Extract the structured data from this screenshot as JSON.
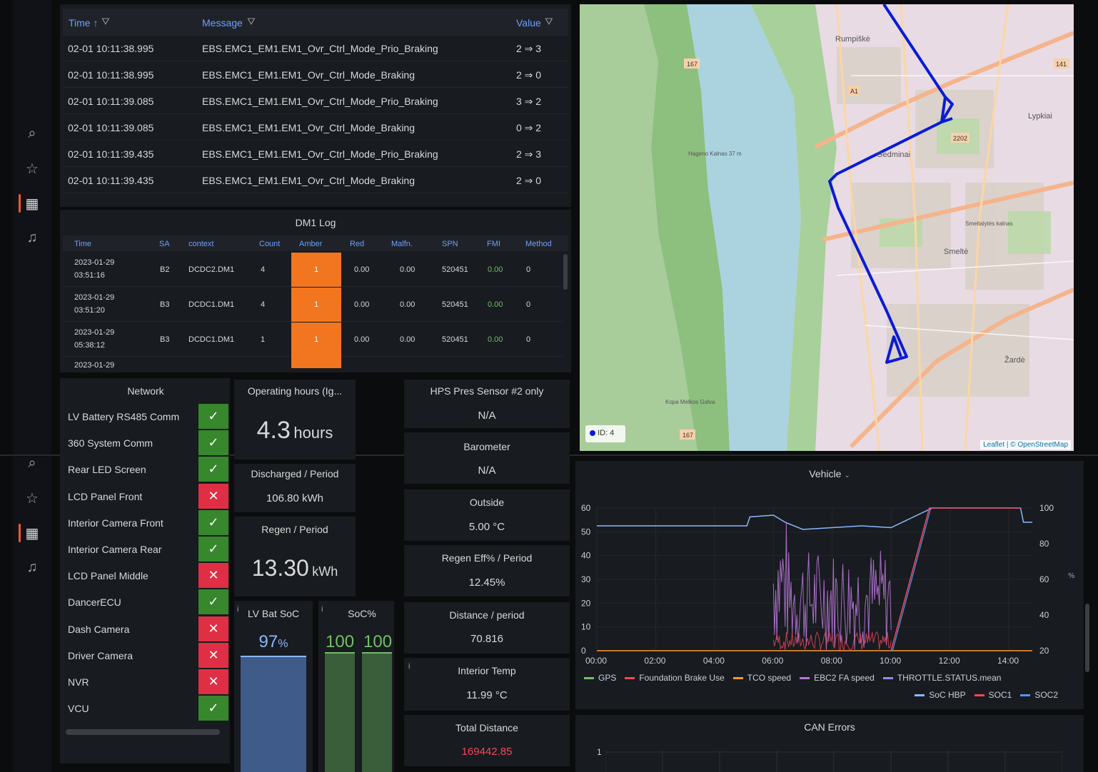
{
  "messages": {
    "headers": {
      "time": "Time ↑",
      "message": "Message",
      "value": "Value"
    },
    "rows": [
      {
        "time": "02-01 10:11:38.995",
        "message": "EBS.EMC1_EM1.EM1_Ovr_Ctrl_Mode_Prio_Braking",
        "value": "2 ⇒ 3"
      },
      {
        "time": "02-01 10:11:38.995",
        "message": "EBS.EMC1_EM1.EM1_Ovr_Ctrl_Mode_Braking",
        "value": "2 ⇒ 0"
      },
      {
        "time": "02-01 10:11:39.085",
        "message": "EBS.EMC1_EM1.EM1_Ovr_Ctrl_Mode_Prio_Braking",
        "value": "3 ⇒ 2"
      },
      {
        "time": "02-01 10:11:39.085",
        "message": "EBS.EMC1_EM1.EM1_Ovr_Ctrl_Mode_Braking",
        "value": "0 ⇒ 2"
      },
      {
        "time": "02-01 10:11:39.435",
        "message": "EBS.EMC1_EM1.EM1_Ovr_Ctrl_Mode_Prio_Braking",
        "value": "2 ⇒ 3"
      },
      {
        "time": "02-01 10:11:39.435",
        "message": "EBS.EMC1_EM1.EM1_Ovr_Ctrl_Mode_Braking",
        "value": "2 ⇒ 0"
      }
    ]
  },
  "dm1": {
    "title": "DM1 Log",
    "headers": {
      "time": "Time",
      "sa": "SA",
      "context": "context",
      "count": "Count",
      "amber": "Amber",
      "red": "Red",
      "malfn": "Malfn.",
      "spn": "SPN",
      "fmi": "FMI",
      "method": "Method"
    },
    "rows": [
      {
        "date": "2023-01-29",
        "clock": "03:51:16",
        "sa": "B2",
        "context": "DCDC2.DM1",
        "count": "4",
        "amber": "1",
        "red": "0.00",
        "malfn": "0.00",
        "spn": "520451",
        "fmi": "0.00",
        "method": "0"
      },
      {
        "date": "2023-01-29",
        "clock": "03:51:20",
        "sa": "B3",
        "context": "DCDC1.DM1",
        "count": "4",
        "amber": "1",
        "red": "0.00",
        "malfn": "0.00",
        "spn": "520451",
        "fmi": "0.00",
        "method": "0"
      },
      {
        "date": "2023-01-29",
        "clock": "05:38:12",
        "sa": "B3",
        "context": "DCDC1.DM1",
        "count": "1",
        "amber": "1",
        "red": "0.00",
        "malfn": "0.00",
        "spn": "520451",
        "fmi": "0.00",
        "method": "0"
      }
    ],
    "partial_row": "2023-01-29"
  },
  "map": {
    "labels": [
      "Rumpiškė",
      "Lypkiai",
      "Smeltė",
      "Žardė",
      "Gedminai",
      "Kopa Melkos Galva",
      "Hageno Kalnas 37 m",
      "Smeltalytės kalnas"
    ],
    "road_labels": [
      "167",
      "A1",
      "2202",
      "141",
      "167"
    ],
    "legend_id": "ID: 4",
    "attribution": "Leaflet | © OpenStreetMap"
  },
  "network": {
    "title": "Network",
    "items": [
      {
        "label": "LV Battery RS485 Comm",
        "ok": true
      },
      {
        "label": "360 System Comm",
        "ok": true
      },
      {
        "label": "Rear LED Screen",
        "ok": true
      },
      {
        "label": "LCD Panel Front",
        "ok": false
      },
      {
        "label": "Interior Camera Front",
        "ok": true
      },
      {
        "label": "Interior Camera Rear",
        "ok": true
      },
      {
        "label": "LCD Panel Middle",
        "ok": false
      },
      {
        "label": "DancerECU",
        "ok": true
      },
      {
        "label": "Dash Camera",
        "ok": false
      },
      {
        "label": "Driver Camera",
        "ok": false
      },
      {
        "label": "NVR",
        "ok": false
      },
      {
        "label": "VCU",
        "ok": true
      }
    ],
    "ok_glyph": "✓",
    "bad_glyph": "✕"
  },
  "stats": {
    "operating_hours": {
      "title": "Operating hours (Ig...",
      "value": "4.3",
      "unit": "hours"
    },
    "discharged": {
      "title": "Discharged / Period",
      "value": "106.80 kWh"
    },
    "regen": {
      "title": "Regen / Period",
      "value": "13.30",
      "unit": "kWh"
    },
    "lv_bat_soc": {
      "title": "LV Bat SoC",
      "value": "97",
      "unit": "%",
      "fraction": 0.97
    },
    "soc": {
      "title": "SoC%",
      "values": [
        "100",
        "100"
      ]
    },
    "hps": {
      "title": "HPS Pres Sensor #2 only",
      "value": "N/A"
    },
    "barometer": {
      "title": "Barometer",
      "value": "N/A"
    },
    "outside": {
      "title": "Outside",
      "value": "5.00 °C"
    },
    "regen_eff": {
      "title": "Regen Eff% / Period",
      "value": "12.45%"
    },
    "distance": {
      "title": "Distance / period",
      "value": "70.816"
    },
    "interior_temp": {
      "title": "Interior Temp",
      "value": "11.99 °C"
    },
    "total_distance": {
      "title": "Total Distance",
      "value": "169442.85"
    }
  },
  "info_glyph": "i",
  "vehicle_chart_title": "Vehicle",
  "chart_data": {
    "type": "line",
    "title": "Vehicle",
    "x": [
      "00:00",
      "02:00",
      "04:00",
      "06:00",
      "08:00",
      "10:00",
      "12:00",
      "14:00"
    ],
    "ylim": [
      0,
      60
    ],
    "y2lim": [
      20,
      100
    ],
    "y_ticks": [
      "60",
      "50",
      "40",
      "30",
      "20",
      "10",
      "0"
    ],
    "y2_ticks": [
      "100",
      "80",
      "60",
      "40",
      "20"
    ],
    "series": [
      {
        "name": "GPS",
        "color": "#73bf69"
      },
      {
        "name": "Foundation Brake Use",
        "color": "#f2495c"
      },
      {
        "name": "TCO speed",
        "color": "#ff9830"
      },
      {
        "name": "EBC2 FA speed",
        "color": "#b877d9"
      },
      {
        "name": "THROTTLE.STATUS.mean",
        "color": "#8f8fe6"
      },
      {
        "name": "SoC HBP",
        "color": "#8ab8ff"
      },
      {
        "name": "SOC1",
        "color": "#f2495c"
      },
      {
        "name": "SOC2",
        "color": "#5794f2"
      }
    ],
    "soc_hbp": [
      [
        0,
        90
      ],
      [
        5.1,
        90
      ],
      [
        5.2,
        95
      ],
      [
        6.0,
        96
      ],
      [
        6.4,
        92
      ],
      [
        7.0,
        88
      ],
      [
        8.0,
        89
      ],
      [
        9.0,
        90
      ],
      [
        10.0,
        89
      ],
      [
        11.4,
        100
      ],
      [
        14.4,
        100
      ],
      [
        14.5,
        92
      ],
      [
        14.8,
        92
      ]
    ]
  },
  "can_errors": {
    "title": "CAN Errors",
    "y_tick": "1"
  }
}
